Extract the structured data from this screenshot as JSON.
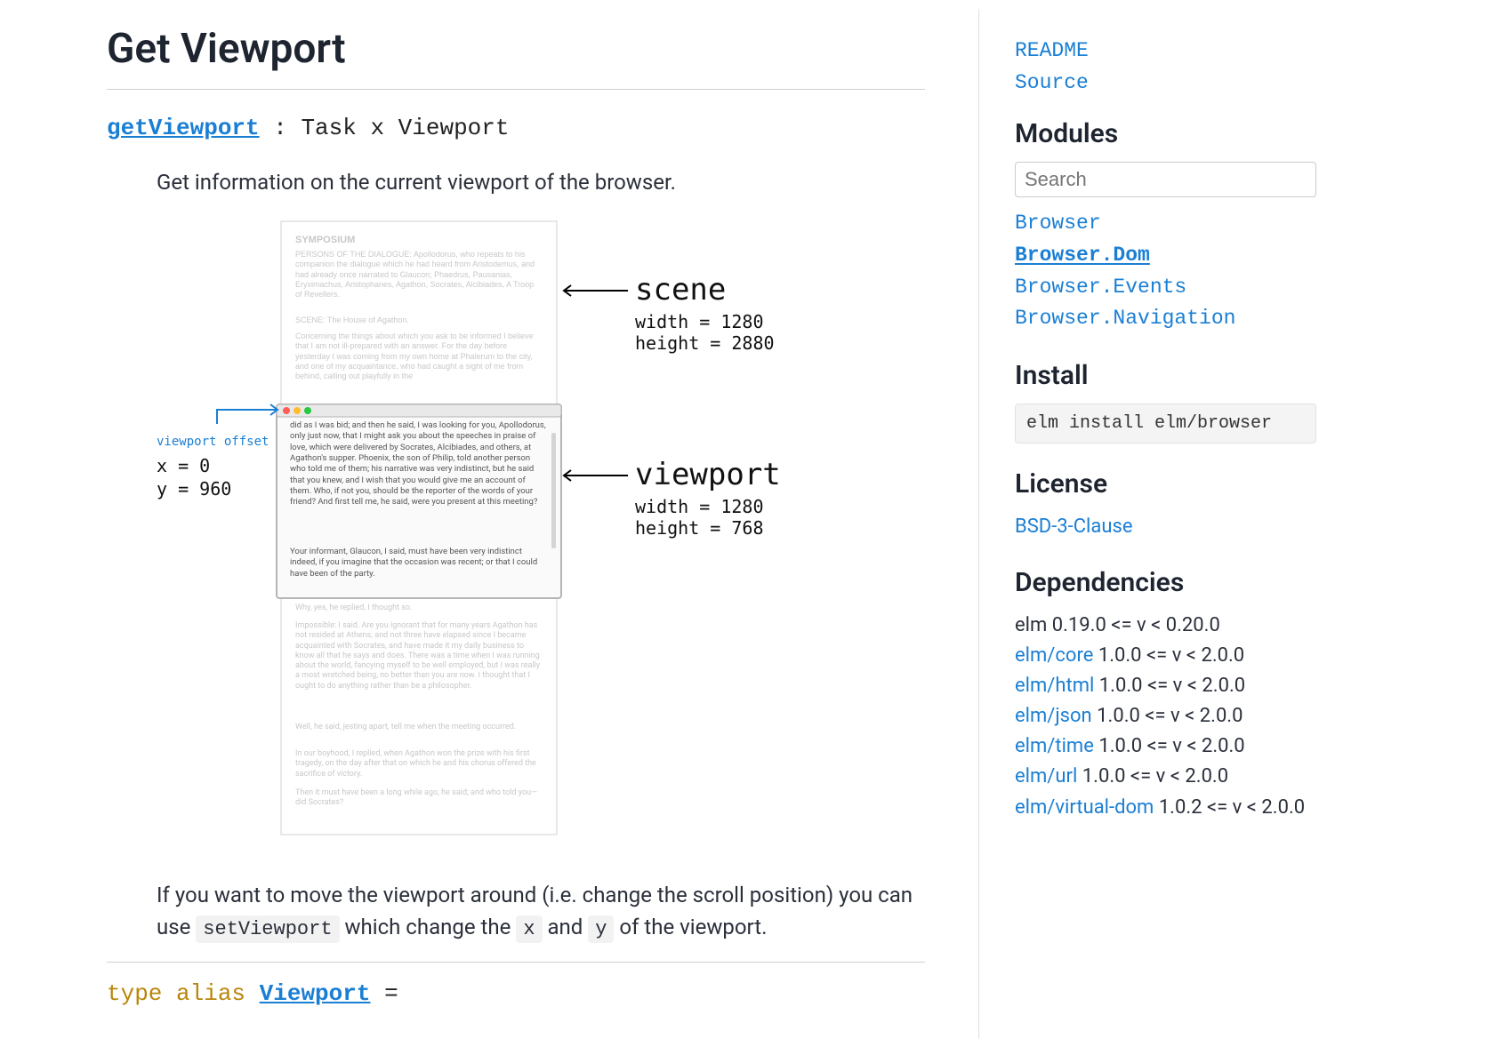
{
  "main": {
    "title": "Get Viewport",
    "signature": {
      "name": "getViewport",
      "colon": " : ",
      "type": "Task x Viewport"
    },
    "desc1": "Get information on the current viewport of the browser.",
    "diagram": {
      "doc_title": "SYMPOSIUM",
      "scene_label": "scene",
      "scene_width": "width  = 1280",
      "scene_height": "height = 2880",
      "viewport_label": "viewport",
      "viewport_width": "width  = 1280",
      "viewport_height": "height = 768",
      "offset_label": "viewport offset",
      "offset_x": "x = 0",
      "offset_y": "y = 960",
      "faded_para1": "PERSONS OF THE DIALOGUE: Apollodorus, who repeats to his companion the dialogue which he had heard from Aristodemus, and had already once narrated to Glaucon; Phaedrus, Pausanias, Eryximachus, Aristophanes, Agathon, Socrates, Alcibiades, A Troop of Revellers.",
      "faded_para2": "SCENE: The House of Agathon.",
      "faded_para3": "Concerning the things about which you ask to be informed I believe that I am not ill-prepared with an answer. For the day before yesterday I was coming from my own home at Phalerum to the city, and one of my acquaintance, who had caught a sight of me from behind, calling out playfully in the",
      "vp_para1": "did as I was bid; and then he said, I was looking for you, Apollodorus, only just now, that I might ask you about the speeches in praise of love, which were delivered by Socrates, Alcibiades, and others, at Agathon's supper. Phoenix, the son of Philip, told another person who told me of them; his narrative was very indistinct, but he said that you knew, and I wish that you would give me an account of them. Who, if not you, should be the reporter of the words of your friend? And first tell me, he said, were you present at this meeting?",
      "vp_para2": "Your informant, Glaucon, I said, must have been very indistinct indeed, if you imagine that the occasion was recent; or that I could have been of the party.",
      "faded_para4": "Why, yes, he replied, I thought so.",
      "faded_para5": "Impossible: I said. Are you ignorant that for many years Agathon has not resided at Athens; and not three have elapsed since I became acquainted with Socrates, and have made it my daily business to know all that he says and does. There was a time when I was running about the world, fancying myself to be well employed, but I was really a most wretched being, no better than you are now. I thought that I ought to do anything rather than be a philosopher.",
      "faded_para6": "Well, he said, jesting apart, tell me when the meeting occurred.",
      "faded_para7": "In our boyhood, I replied, when Agathon won the prize with his first tragedy, on the day after that on which he and his chorus offered the sacrifice of victory.",
      "faded_para8": "Then it must have been a long while ago, he said; and who told you—did Socrates?"
    },
    "desc2_pre": "If you want to move the viewport around (i.e. change the scroll position) you can use ",
    "desc2_code1": "setViewport",
    "desc2_mid": " which change the ",
    "desc2_code2": "x",
    "desc2_and": " and ",
    "desc2_code3": "y",
    "desc2_post": " of the viewport.",
    "next_sig": {
      "kw": "type alias ",
      "name": "Viewport",
      "eq": " ="
    }
  },
  "sidebar": {
    "readme": "README",
    "source": "Source",
    "modules_heading": "Modules",
    "search_placeholder": "Search",
    "modules": {
      "browser": "Browser",
      "browser_dom": "Browser.Dom",
      "browser_events": "Browser.Events",
      "browser_navigation": "Browser.Navigation"
    },
    "install_heading": "Install",
    "install_cmd": "elm install elm/browser",
    "license_heading": "License",
    "license_link": "BSD-3-Clause",
    "deps_heading": "Dependencies",
    "deps": {
      "elm": {
        "name": "elm",
        "version": " 0.19.0 <= v < 0.20.0"
      },
      "core": {
        "name": "elm/core",
        "version": " 1.0.0 <= v < 2.0.0"
      },
      "html": {
        "name": "elm/html",
        "version": " 1.0.0 <= v < 2.0.0"
      },
      "json": {
        "name": "elm/json",
        "version": " 1.0.0 <= v < 2.0.0"
      },
      "time": {
        "name": "elm/time",
        "version": " 1.0.0 <= v < 2.0.0"
      },
      "url": {
        "name": "elm/url",
        "version": " 1.0.0 <= v < 2.0.0"
      },
      "vdom": {
        "name": "elm/virtual-dom",
        "version": " 1.0.2 <= v < 2.0.0"
      }
    }
  }
}
